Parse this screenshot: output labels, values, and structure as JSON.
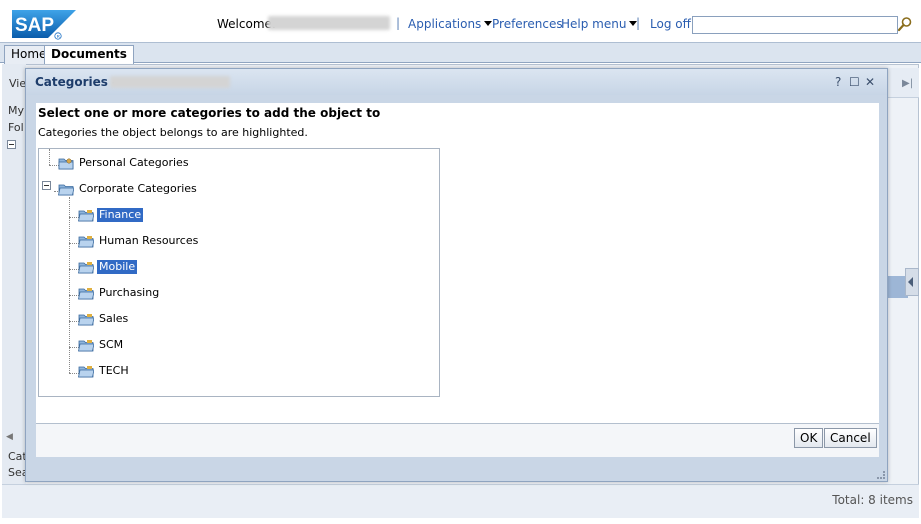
{
  "header": {
    "brand": "SAP",
    "welcome_label": "Welcome:",
    "nav": {
      "applications": "Applications",
      "preferences": "Preferences",
      "help_menu": "Help menu",
      "log_off": "Log off"
    },
    "search_value": ""
  },
  "tabs": [
    {
      "label": "Home"
    },
    {
      "label": "Documents"
    }
  ],
  "background": {
    "fragments": [
      "Vie",
      "My",
      "Fol",
      "Cat",
      "Sea"
    ],
    "status": "Total: 8 items"
  },
  "dialog": {
    "title": "Categories –",
    "heading": "Select one or more categories to add the object to",
    "subheading": "Categories the object belongs to are highlighted.",
    "tree": {
      "personal": "Personal Categories",
      "corporate": "Corporate Categories",
      "children": [
        {
          "label": "Finance",
          "selected": true
        },
        {
          "label": "Human Resources",
          "selected": false
        },
        {
          "label": "Mobile",
          "selected": true
        },
        {
          "label": "Purchasing",
          "selected": false
        },
        {
          "label": "Sales",
          "selected": false
        },
        {
          "label": "SCM",
          "selected": false
        },
        {
          "label": "TECH",
          "selected": false
        }
      ]
    },
    "ok_label": "OK",
    "cancel_label": "Cancel"
  },
  "colors": {
    "selection": "#316ac5",
    "link": "#2a5db0",
    "sap_blue": "#1a6fc4"
  }
}
